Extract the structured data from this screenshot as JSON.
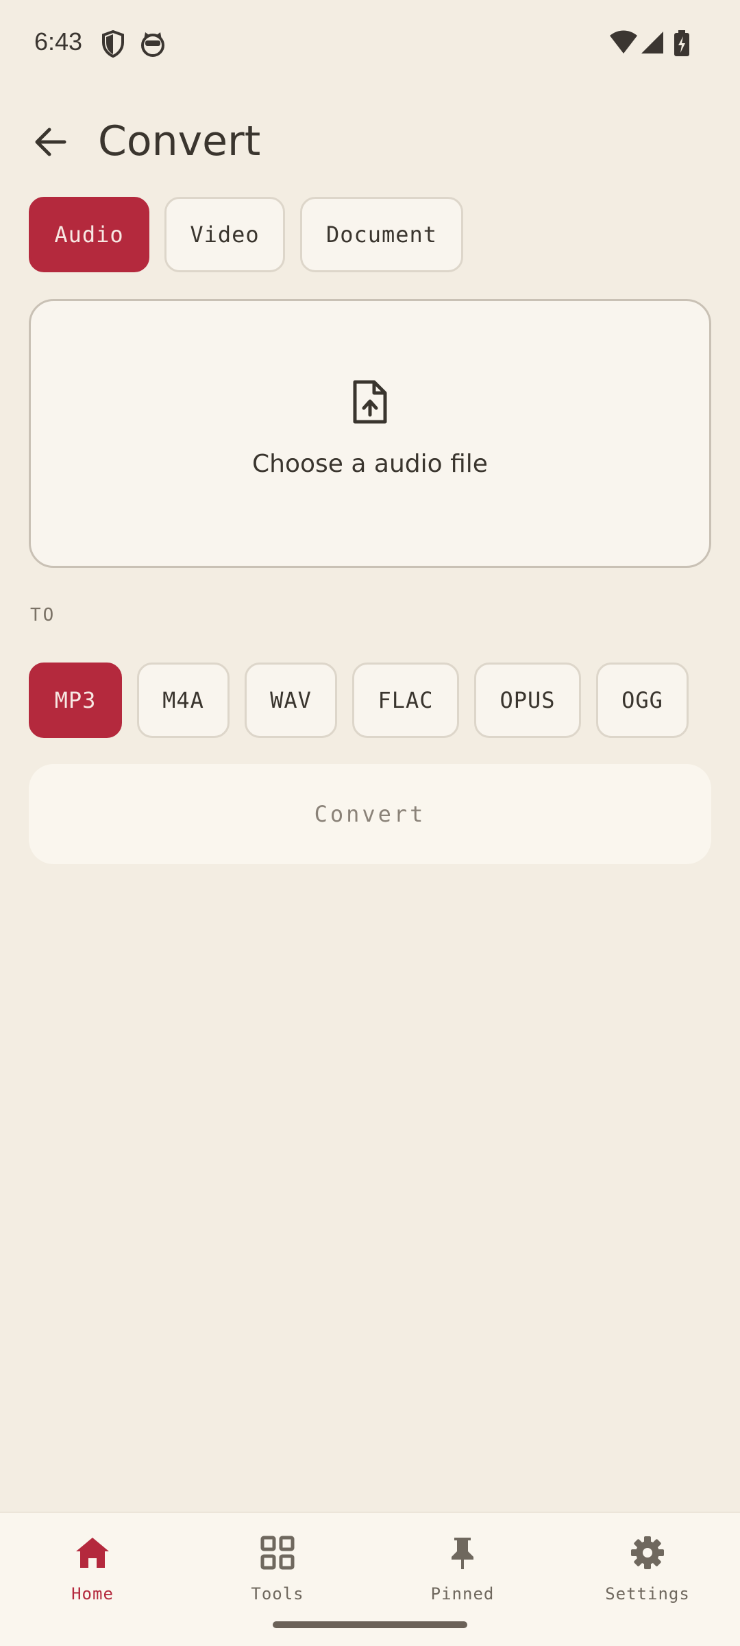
{
  "status_bar": {
    "time": "6:43",
    "icons": [
      "shield-icon",
      "cat-face-icon",
      "wifi-icon",
      "signal-icon",
      "battery-charging-icon"
    ]
  },
  "app_bar": {
    "back_icon": "arrow-back-icon",
    "title": "Convert"
  },
  "source_types": [
    {
      "label": "Audio",
      "selected": true
    },
    {
      "label": "Video",
      "selected": false
    },
    {
      "label": "Document",
      "selected": false
    }
  ],
  "drop_zone": {
    "icon": "file-upload-icon",
    "label": "Choose a audio file"
  },
  "target": {
    "label": "TO",
    "formats": [
      {
        "label": "MP3",
        "selected": true
      },
      {
        "label": "M4A",
        "selected": false
      },
      {
        "label": "WAV",
        "selected": false
      },
      {
        "label": "FLAC",
        "selected": false
      },
      {
        "label": "OPUS",
        "selected": false
      },
      {
        "label": "OGG",
        "selected": false
      }
    ]
  },
  "convert_button": {
    "label": "Convert",
    "enabled": false
  },
  "bottom_nav": {
    "items": [
      {
        "label": "Home",
        "icon": "home-icon",
        "active": true
      },
      {
        "label": "Tools",
        "icon": "grid-icon",
        "active": false
      },
      {
        "label": "Pinned",
        "icon": "pin-icon",
        "active": false
      },
      {
        "label": "Settings",
        "icon": "gear-icon",
        "active": false
      }
    ]
  },
  "colors": {
    "accent": "#b4293d",
    "background": "#f3ede2",
    "surface": "#f9f5ee",
    "text": "#3a352e"
  }
}
